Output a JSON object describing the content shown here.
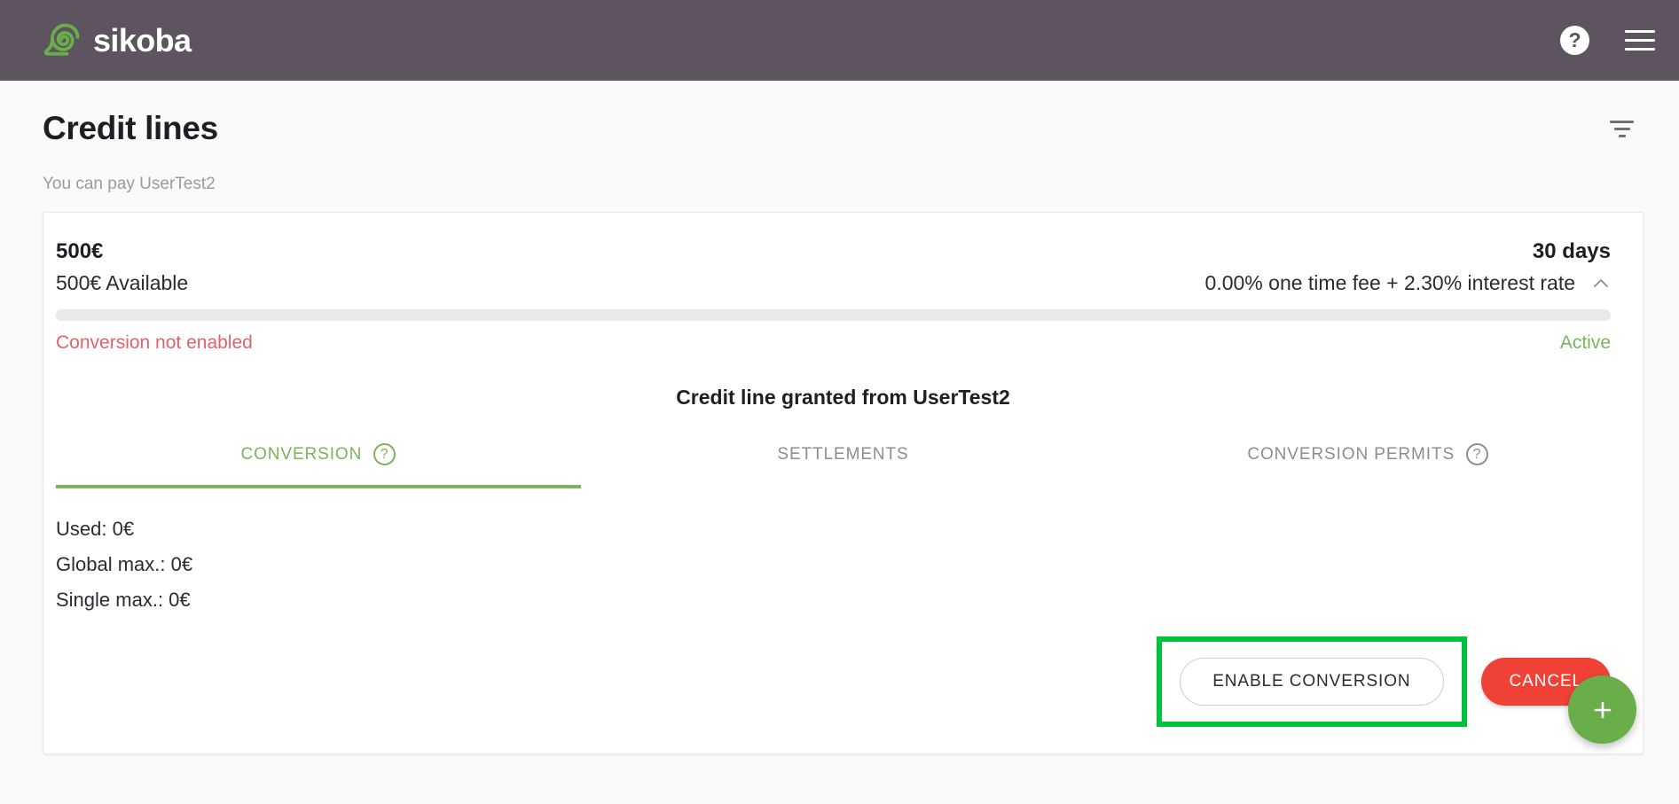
{
  "topbar": {
    "brand_name": "sikoba",
    "logo_icon": "sikoba-snail-spiral-logo",
    "help_label": "?",
    "help_icon": "help-circle-icon",
    "menu_icon": "hamburger-menu-icon"
  },
  "page": {
    "title": "Credit lines",
    "filter_icon": "filter-funnel-icon",
    "subtitle": "You can pay UserTest2"
  },
  "credit_line": {
    "amount": "500€",
    "available": "500€ Available",
    "term": "30 days",
    "rate": "0.00% one time fee + 2.30% interest rate",
    "collapse_icon": "chevron-up-icon",
    "progress_percent": 0,
    "status_left": "Conversion not enabled",
    "status_right": "Active",
    "granted_title": "Credit line granted from UserTest2"
  },
  "tabs": [
    {
      "label": "CONVERSION",
      "active": true,
      "help_icon": "help-circle-outline-icon",
      "help_label": "?"
    },
    {
      "label": "SETTLEMENTS",
      "active": false,
      "help_icon": null,
      "help_label": ""
    },
    {
      "label": "CONVERSION PERMITS",
      "active": false,
      "help_icon": "help-circle-outline-icon",
      "help_label": "?"
    }
  ],
  "conversion": {
    "used": "Used: 0€",
    "global_max": "Global max.: 0€",
    "single_max": "Single max.: 0€"
  },
  "actions": {
    "enable_label": "ENABLE CONVERSION",
    "cancel_label": "CANCEL",
    "fab_icon": "plus-icon"
  },
  "colors": {
    "header_bg": "#5e5460",
    "brand_green": "#6aae4a",
    "accent_green": "#7ab55c",
    "danger_red": "#ef4136",
    "error_text": "#e2616b",
    "highlight_box": "#00c23c",
    "page_bg": "#fafafa"
  }
}
